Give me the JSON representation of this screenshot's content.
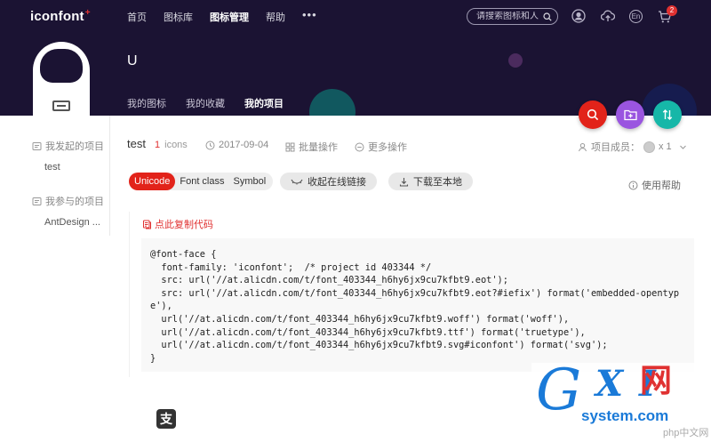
{
  "header": {
    "logo": "iconfont",
    "logo_mark": "+",
    "nav": [
      "首页",
      "图标库",
      "图标管理",
      "帮助"
    ],
    "nav_more": "•••",
    "search_placeholder": "请搜索图标和人",
    "lang": "En",
    "cart_count": "2",
    "user_name": "U",
    "tabs": [
      "我的图标",
      "我的收藏",
      "我的项目"
    ]
  },
  "sidebar": {
    "my_projects_label": "我发起的项目",
    "my_projects": [
      "test"
    ],
    "joined_projects_label": "我参与的项目",
    "joined_projects": [
      "AntDesign ..."
    ]
  },
  "project": {
    "name": "test",
    "icon_count": "1",
    "icon_unit": "icons",
    "date": "2017-09-04",
    "batch_action": "批量操作",
    "more_action": "更多操作",
    "members_label": "项目成员：",
    "members_count": "x 1"
  },
  "formats": [
    "Unicode",
    "Font class",
    "Symbol"
  ],
  "actions": {
    "collapse_link": "收起在线链接",
    "download": "下载至本地",
    "help": "使用帮助",
    "copy_code": "点此复制代码"
  },
  "code": "@font-face {\n  font-family: 'iconfont';  /* project id 403344 */\n  src: url('//at.alicdn.com/t/font_403344_h6hy6jx9cu7kfbt9.eot');\n  src: url('//at.alicdn.com/t/font_403344_h6hy6jx9cu7kfbt9.eot?#iefix') format('embedded-opentype'),\n  url('//at.alicdn.com/t/font_403344_h6hy6jx9cu7kfbt9.woff') format('woff'),\n  url('//at.alicdn.com/t/font_403344_h6hy6jx9cu7kfbt9.ttf') format('truetype'),\n  url('//at.alicdn.com/t/font_403344_h6hy6jx9cu7kfbt9.svg#iconfont') format('svg');\n}",
  "alipay_glyph": "支",
  "watermark": {
    "g": "G",
    "xi": "X I",
    "cn": "网",
    "site": "system.com",
    "php": "php中文网"
  },
  "colors": {
    "header_bg": "#1b1333",
    "accent_red": "#e2231a",
    "purple": "#9a55e0",
    "teal": "#16b7a8"
  },
  "icons": [
    "user-icon",
    "upload-icon",
    "cart-icon",
    "search-icon",
    "folder-add-icon",
    "sort-icon",
    "folder-icon",
    "clock-icon",
    "grid-icon",
    "minus-circle-icon",
    "members-icon",
    "chevron-down-icon",
    "link-icon",
    "download-icon",
    "help-icon",
    "copy-icon"
  ]
}
